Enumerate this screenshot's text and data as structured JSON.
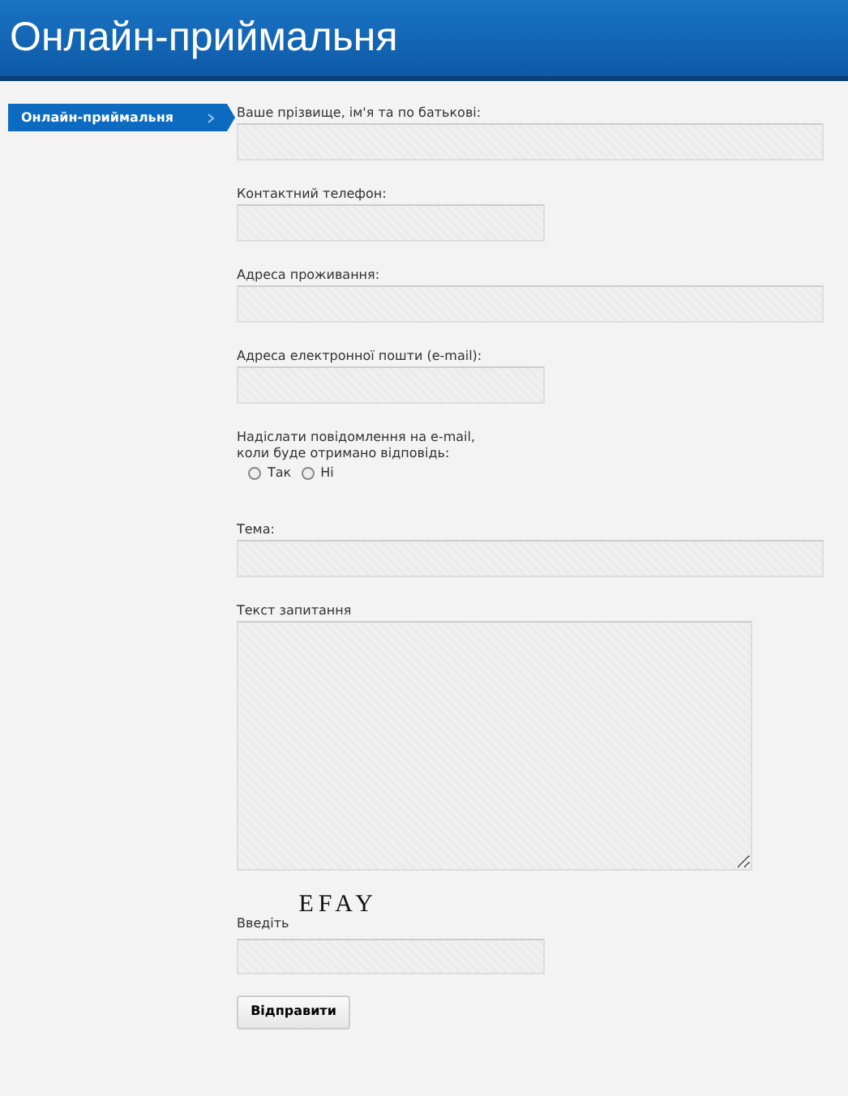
{
  "header": {
    "title": "Онлайн-приймальня"
  },
  "sidebar": {
    "items": [
      {
        "label": "Онлайн-приймальня",
        "selected": true
      }
    ]
  },
  "form": {
    "fields": [
      {
        "kind": "text",
        "label": "Ваше прізвище, ім'я та по батькові:"
      },
      {
        "kind": "text",
        "label": "Контактний телефон:"
      },
      {
        "kind": "text",
        "label": "Адреса проживання:"
      },
      {
        "kind": "text",
        "label": "Адреса електронної пошти (e-mail):"
      },
      {
        "kind": "radio",
        "label": "Надіслати повідомлення на e-mail,\nколи буде отримано відповідь:",
        "options": [
          {
            "label": "Так",
            "selected": false
          },
          {
            "label": "Ні",
            "selected": false
          }
        ]
      },
      {
        "kind": "text",
        "label": "Тема:"
      },
      {
        "kind": "textarea",
        "label": "Текст запитання"
      },
      {
        "kind": "captcha",
        "label": "Введіть",
        "code": "EFAY"
      }
    ],
    "submit": "Відправити"
  }
}
